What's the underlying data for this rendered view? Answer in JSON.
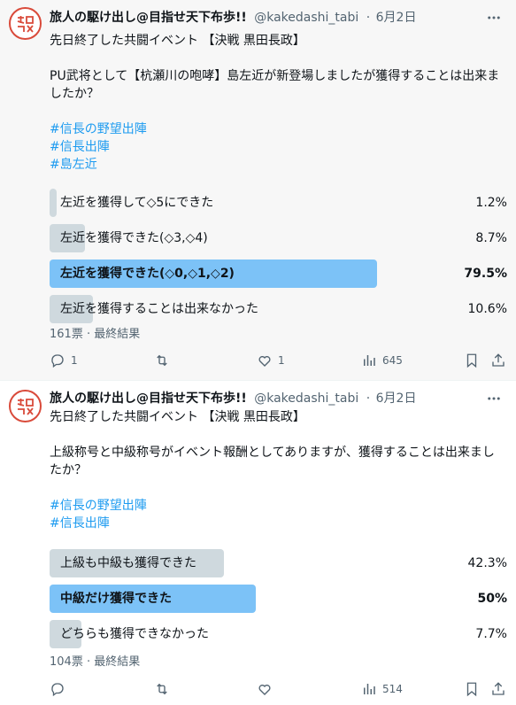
{
  "tweets": [
    {
      "author": {
        "name": "旅人の駆け出し@目指せ天下布歩!!",
        "handle": "@kakedashi_tabi",
        "date": "6月2日",
        "sep": "·"
      },
      "text": {
        "line1": "先日終了した共闘イベント 【決戦 黒田長政】",
        "line2": "PU武将として【杭瀬川の咆哮】島左近が新登場しましたが獲得することは出来ましたか？"
      },
      "hashtags": [
        "#信長の野望出陣",
        "#信長出陣",
        "#島左近"
      ],
      "poll": {
        "options": [
          {
            "label": "左近を獲得して◇5にできた",
            "percent": "1.2%",
            "value": 1.2
          },
          {
            "label": "左近を獲得できた(◇3,◇4)",
            "percent": "8.7%",
            "value": 8.7
          },
          {
            "label": "左近を獲得できた(◇0,◇1,◇2)",
            "percent": "79.5%",
            "value": 79.5,
            "winner": true
          },
          {
            "label": "左近を獲得することは出来なかった",
            "percent": "10.6%",
            "value": 10.6
          }
        ],
        "votes": "161票",
        "status": "最終結果",
        "status_sep": "·"
      },
      "actions": {
        "reply": "1",
        "retweet": "",
        "like": "1",
        "views": "645"
      }
    },
    {
      "author": {
        "name": "旅人の駆け出し@目指せ天下布歩!!",
        "handle": "@kakedashi_tabi",
        "date": "6月2日",
        "sep": "·"
      },
      "text": {
        "line1": "先日終了した共闘イベント 【決戦 黒田長政】",
        "line2": "上級称号と中級称号がイベント報酬としてありますが、獲得することは出来ましたか？"
      },
      "hashtags": [
        "#信長の野望出陣",
        "#信長出陣"
      ],
      "poll": {
        "options": [
          {
            "label": "上級も中級も獲得できた",
            "percent": "42.3%",
            "value": 42.3
          },
          {
            "label": "中級だけ獲得できた",
            "percent": "50%",
            "value": 50,
            "winner": true
          },
          {
            "label": "どちらも獲得できなかった",
            "percent": "7.7%",
            "value": 7.7
          }
        ],
        "votes": "104票",
        "status": "最終結果",
        "status_sep": "·"
      },
      "actions": {
        "reply": "",
        "retweet": "",
        "like": "",
        "views": "514"
      }
    }
  ],
  "colors": {
    "accent": "#1d9bf0",
    "winner_bar": "#7cc2f7",
    "bar": "#cfd9de",
    "muted": "#536471"
  },
  "icons": [
    "avatar-seal",
    "more-icon",
    "reply-icon",
    "retweet-icon",
    "like-icon",
    "views-icon",
    "bookmark-icon",
    "share-icon"
  ]
}
